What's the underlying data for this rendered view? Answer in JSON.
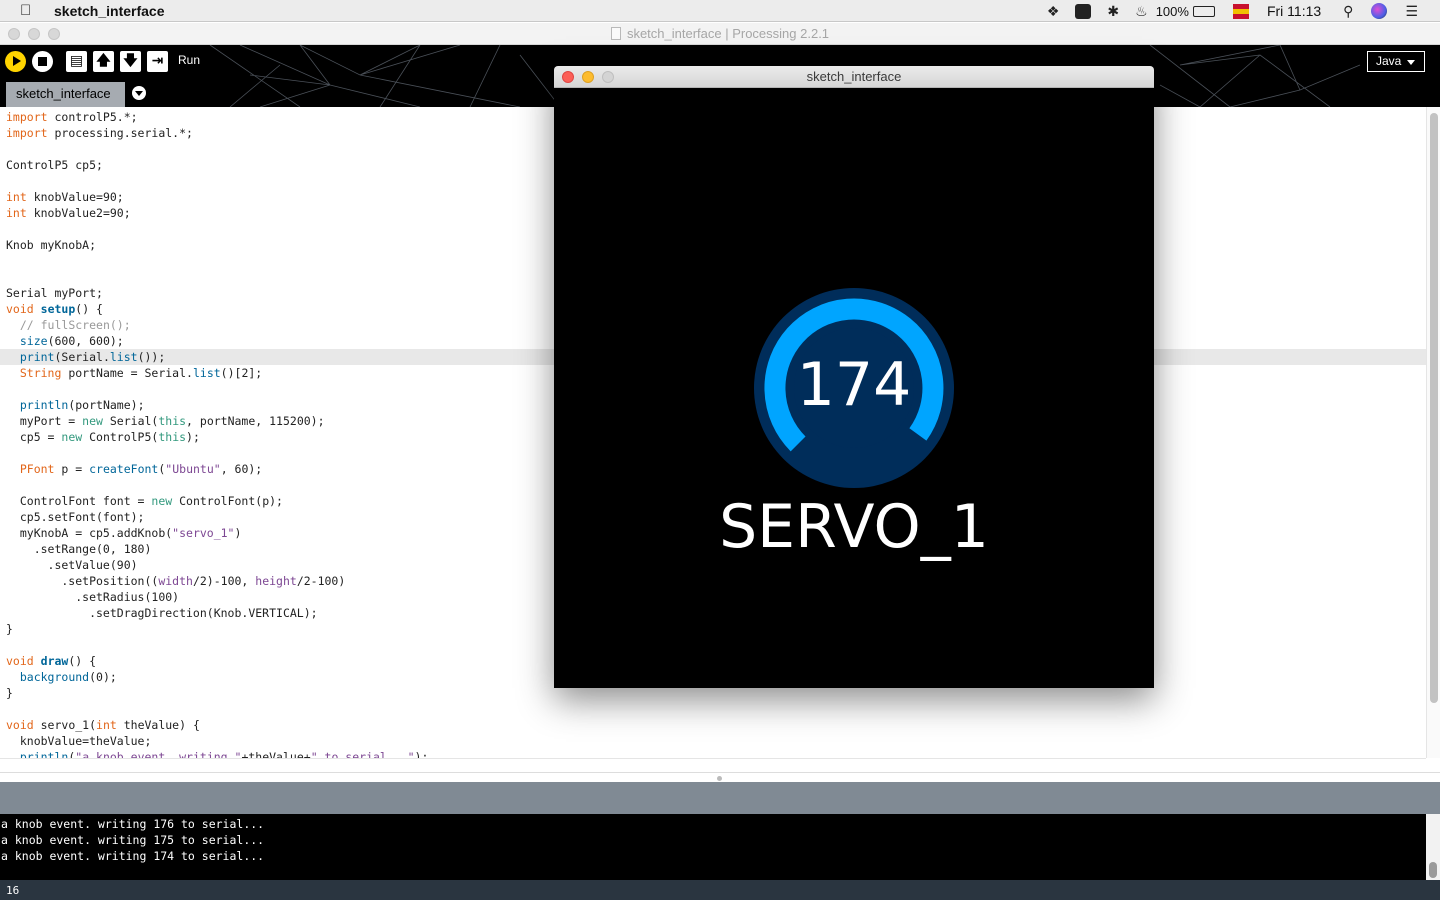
{
  "menubar": {
    "app_name": "sketch_interface",
    "battery": "100%",
    "clock": "Fri 11:13"
  },
  "window": {
    "title": "sketch_interface | Processing 2.2.1"
  },
  "toolbar": {
    "run_label": "Run",
    "mode": "Java",
    "tab": "sketch_interface"
  },
  "editor": {
    "highlighted_line": 16,
    "lines": [
      [
        {
          "t": "import",
          "c": "kw"
        },
        {
          "t": " controlP5.*;",
          "c": "tx"
        }
      ],
      [
        {
          "t": "import",
          "c": "kw"
        },
        {
          "t": " processing.serial.*;",
          "c": "tx"
        }
      ],
      [],
      [
        {
          "t": "ControlP5 cp5;",
          "c": "tx"
        }
      ],
      [],
      [
        {
          "t": "int",
          "c": "kw"
        },
        {
          "t": " knobValue=90;",
          "c": "tx"
        }
      ],
      [
        {
          "t": "int",
          "c": "kw"
        },
        {
          "t": " knobValue2=90;",
          "c": "tx"
        }
      ],
      [],
      [
        {
          "t": "Knob myKnobA;",
          "c": "tx"
        }
      ],
      [],
      [],
      [
        {
          "t": "Serial myPort;",
          "c": "tx"
        }
      ],
      [
        {
          "t": "void",
          "c": "kw"
        },
        {
          "t": " ",
          "c": "tx"
        },
        {
          "t": "setup",
          "c": "fnb"
        },
        {
          "t": "() {",
          "c": "tx"
        }
      ],
      [
        {
          "t": "  ",
          "c": "tx"
        },
        {
          "t": "// fullScreen();",
          "c": "cm"
        }
      ],
      [
        {
          "t": "  ",
          "c": "tx"
        },
        {
          "t": "size",
          "c": "fn"
        },
        {
          "t": "(600, 600);",
          "c": "tx"
        }
      ],
      [
        {
          "t": "  ",
          "c": "tx"
        },
        {
          "t": "print",
          "c": "fn"
        },
        {
          "t": "(Serial.",
          "c": "tx"
        },
        {
          "t": "list",
          "c": "fn"
        },
        {
          "t": "());",
          "c": "tx"
        }
      ],
      [
        {
          "t": "  ",
          "c": "tx"
        },
        {
          "t": "String",
          "c": "kw"
        },
        {
          "t": " portName = Serial.",
          "c": "tx"
        },
        {
          "t": "list",
          "c": "fn"
        },
        {
          "t": "()[2];",
          "c": "tx"
        }
      ],
      [],
      [
        {
          "t": "  ",
          "c": "tx"
        },
        {
          "t": "println",
          "c": "fn"
        },
        {
          "t": "(portName);",
          "c": "tx"
        }
      ],
      [
        {
          "t": "  myPort = ",
          "c": "tx"
        },
        {
          "t": "new",
          "c": "lit"
        },
        {
          "t": " Serial(",
          "c": "tx"
        },
        {
          "t": "this",
          "c": "lit"
        },
        {
          "t": ", portName, 115200);",
          "c": "tx"
        }
      ],
      [
        {
          "t": "  cp5 = ",
          "c": "tx"
        },
        {
          "t": "new",
          "c": "lit"
        },
        {
          "t": " ControlP5(",
          "c": "tx"
        },
        {
          "t": "this",
          "c": "lit"
        },
        {
          "t": ");",
          "c": "tx"
        }
      ],
      [],
      [
        {
          "t": "  ",
          "c": "tx"
        },
        {
          "t": "PFont",
          "c": "kw"
        },
        {
          "t": " p = ",
          "c": "tx"
        },
        {
          "t": "createFont",
          "c": "fn"
        },
        {
          "t": "(",
          "c": "tx"
        },
        {
          "t": "\"Ubuntu\"",
          "c": "st"
        },
        {
          "t": ", 60);",
          "c": "tx"
        }
      ],
      [],
      [
        {
          "t": "  ControlFont font = ",
          "c": "tx"
        },
        {
          "t": "new",
          "c": "lit"
        },
        {
          "t": " ControlFont(p);",
          "c": "tx"
        }
      ],
      [
        {
          "t": "  cp5.setFont(font);",
          "c": "tx"
        }
      ],
      [
        {
          "t": "  myKnobA = cp5.addKnob(",
          "c": "tx"
        },
        {
          "t": "\"servo_1\"",
          "c": "st"
        },
        {
          "t": ")",
          "c": "tx"
        }
      ],
      [
        {
          "t": "    .setRange(0, 180)",
          "c": "tx"
        }
      ],
      [
        {
          "t": "      .setValue(90)",
          "c": "tx"
        }
      ],
      [
        {
          "t": "        .setPosition((",
          "c": "tx"
        },
        {
          "t": "width",
          "c": "st"
        },
        {
          "t": "/2)-100, ",
          "c": "tx"
        },
        {
          "t": "height",
          "c": "st"
        },
        {
          "t": "/2-100)",
          "c": "tx"
        }
      ],
      [
        {
          "t": "          .setRadius(100)",
          "c": "tx"
        }
      ],
      [
        {
          "t": "            .setDragDirection(Knob.VERTICAL);",
          "c": "tx"
        }
      ],
      [
        {
          "t": "}",
          "c": "tx"
        }
      ],
      [],
      [
        {
          "t": "void",
          "c": "kw"
        },
        {
          "t": " ",
          "c": "tx"
        },
        {
          "t": "draw",
          "c": "fnb"
        },
        {
          "t": "() {",
          "c": "tx"
        }
      ],
      [
        {
          "t": "  ",
          "c": "tx"
        },
        {
          "t": "background",
          "c": "fn"
        },
        {
          "t": "(0);",
          "c": "tx"
        }
      ],
      [
        {
          "t": "}",
          "c": "tx"
        }
      ],
      [],
      [
        {
          "t": "void",
          "c": "kw"
        },
        {
          "t": " servo_1(",
          "c": "tx"
        },
        {
          "t": "int",
          "c": "kw"
        },
        {
          "t": " theValue) {",
          "c": "tx"
        }
      ],
      [
        {
          "t": "  knobValue=theValue;",
          "c": "tx"
        }
      ],
      [
        {
          "t": "  ",
          "c": "tx"
        },
        {
          "t": "println",
          "c": "fn"
        },
        {
          "t": "(",
          "c": "tx"
        },
        {
          "t": "\"a knob event. writing \"",
          "c": "st"
        },
        {
          "t": "+theValue+",
          "c": "tx"
        },
        {
          "t": "\" to serial...\"",
          "c": "st"
        },
        {
          "t": ");",
          "c": "tx"
        }
      ]
    ]
  },
  "console": {
    "lines": [
      "a knob event. writing 176 to serial...",
      "a knob event. writing 175 to serial...",
      "a knob event. writing 174 to serial..."
    ]
  },
  "status": {
    "line_number": "16"
  },
  "sketch_window": {
    "title": "sketch_interface",
    "knob": {
      "label": "SERVO_1",
      "value": "174",
      "value_num": 174,
      "range": [
        0,
        180
      ]
    }
  },
  "colors": {
    "knob_active": "#00a5ff",
    "knob_background": "#002d5a",
    "run_button": "#ffd400"
  }
}
